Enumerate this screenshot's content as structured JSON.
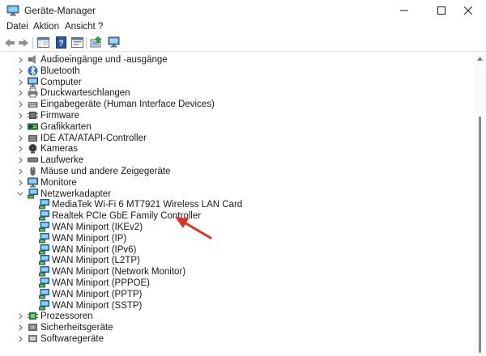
{
  "window": {
    "title": "Geräte-Manager"
  },
  "menu": [
    "Datei",
    "Aktion",
    "Ansicht",
    "?"
  ],
  "colors": {
    "annotation_arrow": "#e0302a",
    "monitor_blue": "#2e8bd8"
  },
  "tree": {
    "items": [
      {
        "label": "Audioeingänge und -ausgänge",
        "icon": "speaker-icon",
        "state": "collapsed"
      },
      {
        "label": "Bluetooth",
        "icon": "bluetooth-icon",
        "state": "collapsed"
      },
      {
        "label": "Computer",
        "icon": "computer-icon",
        "state": "collapsed"
      },
      {
        "label": "Druckwarteschlangen",
        "icon": "printer-icon",
        "state": "collapsed"
      },
      {
        "label": "Eingabegeräte (Human Interface Devices)",
        "icon": "hid-icon",
        "state": "collapsed"
      },
      {
        "label": "Firmware",
        "icon": "firmware-icon",
        "state": "collapsed"
      },
      {
        "label": "Grafikkarten",
        "icon": "display-adapter-icon",
        "state": "collapsed"
      },
      {
        "label": "IDE ATA/ATAPI-Controller",
        "icon": "ide-controller-icon",
        "state": "collapsed"
      },
      {
        "label": "Kameras",
        "icon": "camera-icon",
        "state": "collapsed"
      },
      {
        "label": "Laufwerke",
        "icon": "disk-drive-icon",
        "state": "collapsed"
      },
      {
        "label": "Mäuse und andere Zeigegeräte",
        "icon": "mouse-icon",
        "state": "collapsed"
      },
      {
        "label": "Monitore",
        "icon": "monitor-icon",
        "state": "collapsed"
      },
      {
        "label": "Netzwerkadapter",
        "icon": "network-adapter-icon",
        "state": "expanded"
      },
      {
        "label": "MediaTek Wi-Fi 6 MT7921 Wireless LAN Card",
        "icon": "network-adapter-icon",
        "state": "child"
      },
      {
        "label": "Realtek PCIe GbE Family Controller",
        "icon": "network-adapter-icon",
        "state": "child"
      },
      {
        "label": "WAN Miniport (IKEv2)",
        "icon": "network-adapter-icon",
        "state": "child"
      },
      {
        "label": "WAN Miniport (IP)",
        "icon": "network-adapter-icon",
        "state": "child"
      },
      {
        "label": "WAN Miniport (IPv6)",
        "icon": "network-adapter-icon",
        "state": "child"
      },
      {
        "label": "WAN Miniport (L2TP)",
        "icon": "network-adapter-icon",
        "state": "child"
      },
      {
        "label": "WAN Miniport (Network Monitor)",
        "icon": "network-adapter-icon",
        "state": "child"
      },
      {
        "label": "WAN Miniport (PPPOE)",
        "icon": "network-adapter-icon",
        "state": "child"
      },
      {
        "label": "WAN Miniport (PPTP)",
        "icon": "network-adapter-icon",
        "state": "child"
      },
      {
        "label": "WAN Miniport (SSTP)",
        "icon": "network-adapter-icon",
        "state": "child"
      },
      {
        "label": "Prozessoren",
        "icon": "processor-icon",
        "state": "collapsed"
      },
      {
        "label": "Sicherheitsgeräte",
        "icon": "security-device-icon",
        "state": "collapsed"
      },
      {
        "label": "Softwaregeräte",
        "icon": "software-device-icon",
        "state": "collapsed"
      }
    ]
  }
}
